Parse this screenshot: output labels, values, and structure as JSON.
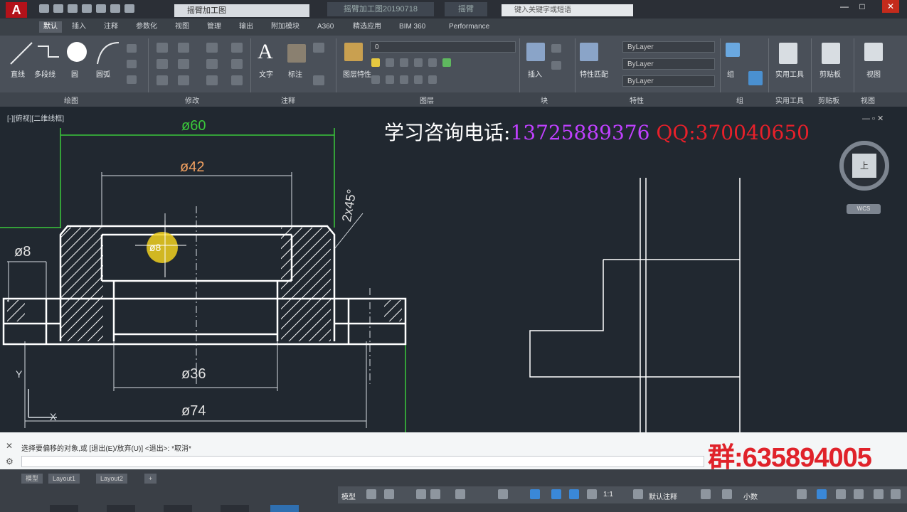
{
  "app": {
    "logo": "A",
    "doc_tab": "摇臂加工图",
    "doc_tab2": "摇臂加工图20190718",
    "doc_tab3": "摇臂",
    "search_placeholder": "键入关键字或短语"
  },
  "ribbon": {
    "tabs": [
      "默认",
      "插入",
      "注释",
      "参数化",
      "视图",
      "管理",
      "输出",
      "附加模块",
      "A360",
      "精选应用",
      "BIM 360",
      "Performance"
    ],
    "active_tab": "默认",
    "tools": [
      "直线",
      "多段线",
      "圆",
      "圆弧",
      "文字",
      "标注",
      "图层特性",
      "插入",
      "特性匹配",
      "组",
      "实用工具",
      "剪贴板",
      "视图"
    ],
    "panels": [
      "绘图",
      "修改",
      "注释",
      "图层",
      "块",
      "特性",
      "组",
      "实用工具",
      "剪贴板",
      "视图"
    ],
    "layer_value": "0",
    "prop_color": "ByLayer",
    "prop_linetype": "ByLayer",
    "prop_lineweight": "ByLayer"
  },
  "viewport": {
    "label": "[-][俯视][二维线框]",
    "ad_phone_label": "学习咨询电话:",
    "ad_phone_number": "13725889376",
    "ad_qq": "QQ:370040650",
    "viewcube_label": "上",
    "wcs_label": "WCS"
  },
  "drawing": {
    "dim_phi60": "ø60",
    "dim_phi42": "ø42",
    "dim_phi8": "ø8",
    "dim_phi36": "ø36",
    "dim_phi74": "ø74",
    "dim_chamfer": "2x45°",
    "cursor_label": "ø8",
    "axis_x": "X",
    "axis_y": "Y"
  },
  "command": {
    "prompt": "选择要偏移的对象,或 [退出(E)/放弃(U)] <退出>: *取消*",
    "group_ad": "群:635894005"
  },
  "layout_tabs": [
    "模型",
    "Layout1",
    "Layout2",
    "+"
  ],
  "status": {
    "model_label": "模型",
    "scale": "1:1",
    "annotation": "默认注释",
    "units": "小数"
  },
  "colors": {
    "ad_number": "#c040ff",
    "ad_qq": "#e8202a",
    "group_ad": "#e0222a",
    "dim_green": "#3ac83a",
    "dim_orange": "#f0a060"
  }
}
